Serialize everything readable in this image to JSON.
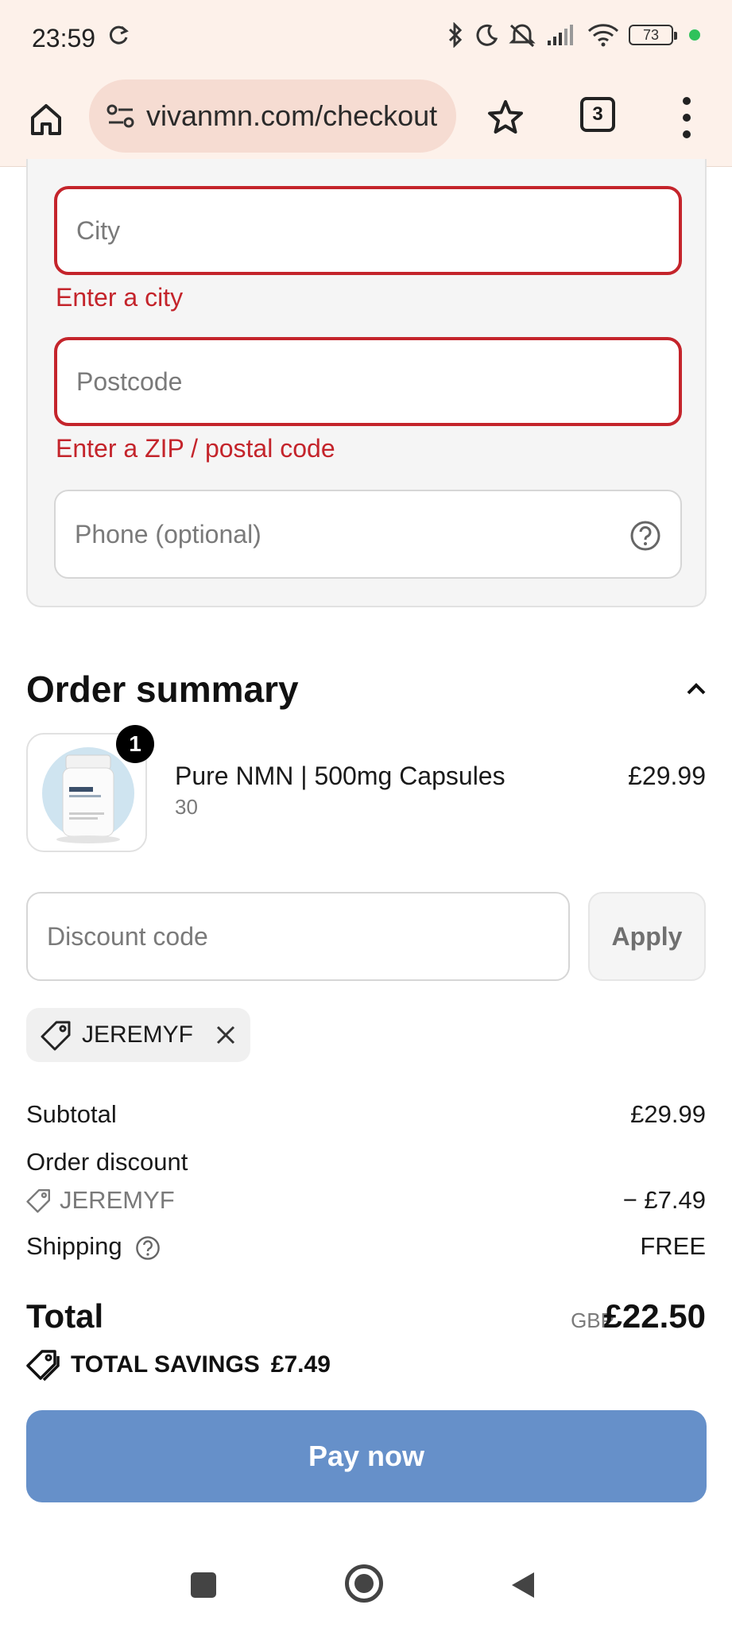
{
  "status_bar": {
    "time": "23:59",
    "battery": "73",
    "icons": [
      "sync-icon",
      "bluetooth-icon",
      "moon-icon",
      "mute-icon",
      "signal-icon",
      "wifi-icon",
      "battery-icon"
    ]
  },
  "browser": {
    "url": "vivanmn.com/checkout",
    "tab_count": "3"
  },
  "form": {
    "city_placeholder": "City",
    "city_error": "Enter a city",
    "postcode_placeholder": "Postcode",
    "postcode_error": "Enter a ZIP / postal code",
    "phone_placeholder": "Phone (optional)"
  },
  "order_summary": {
    "title": "Order summary",
    "item": {
      "quantity": "1",
      "name": "Pure NMN | 500mg Capsules",
      "variant": "30",
      "price": "£29.99"
    },
    "discount_placeholder": "Discount code",
    "apply_label": "Apply",
    "applied_code": "JEREMYF",
    "subtotal_label": "Subtotal",
    "subtotal_value": "£29.99",
    "order_discount_label": "Order discount",
    "order_discount_code": "JEREMYF",
    "order_discount_value": "− £7.49",
    "shipping_label": "Shipping",
    "shipping_value": "FREE",
    "total_label": "Total",
    "total_currency": "GBP",
    "total_value": "£22.50",
    "savings_label": "TOTAL SAVINGS",
    "savings_value": "£7.49",
    "pay_label": "Pay now"
  },
  "colors": {
    "error": "#c4242b",
    "pay_button": "#6690c9",
    "browser_bar": "#fdf1ea"
  }
}
